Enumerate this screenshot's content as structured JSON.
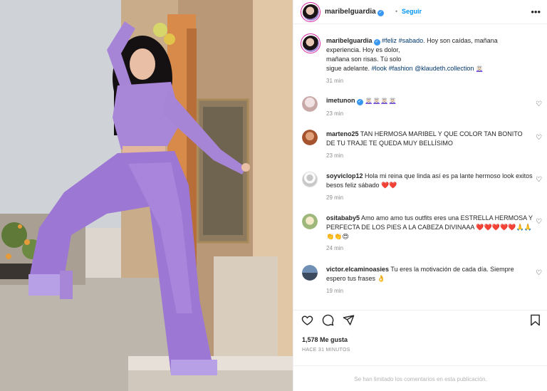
{
  "colors": {
    "accent": "#0095f6",
    "verified": "#3897f0",
    "muted": "#8e8e8e",
    "hashtag": "#00376b",
    "outfit": "#9c77d3"
  },
  "header": {
    "username": "maribelguardia",
    "verified_icon": "verified-badge-icon",
    "separator": "•",
    "follow_label": "Seguir",
    "more_icon": "more-options-icon",
    "more_glyph": "•••"
  },
  "caption": {
    "username": "maribelguardia",
    "parts": {
      "t1": "#feliz",
      "t2": "#sabado",
      "line1": ". Hoy son caídas, mañana",
      "line2": "experiencia. Hoy es dolor,",
      "line3": "mañana son risas. Tú solo",
      "line4a": "sigue adelante. ",
      "t3": "#look",
      "t4": "#fashion",
      "mention": "@klaudeth.collection",
      "emoji": "🧝🏻‍♀️"
    },
    "time": "31 min"
  },
  "comments": [
    {
      "username": "imetunon",
      "verified": true,
      "text": "🧝🏻‍♀️🧝🏻‍♀️🧝🏻‍♀️🧝🏻‍♀️",
      "time": "23 min"
    },
    {
      "username": "marteno25",
      "text": "TAN HERMOSA MARIBEL Y QUE COLOR TAN BONITO DE TU TRAJE TE QUEDA MUY BELLÍSIMO",
      "time": "23 min"
    },
    {
      "username": "soyviclop12",
      "text": "Hola mi reina que linda así es pa lante hermoso look exitos besos feliz sábado ❤️❤️",
      "time": "29 min"
    },
    {
      "username": "ositababy5",
      "text": "Amo amo amo tus outfits eres una ESTRELLA HERMOSA Y PERFECTA DE LOS PIES A LA CABEZA DIVINAAA ❤️❤️❤️❤️❤️🙏🙏👏👏😍",
      "time": "24 min"
    },
    {
      "username": "victor.elcaminoasies",
      "text": "Tu eres la motivación de cada día. Siempre espero tus frases 👌",
      "time": "19 min"
    }
  ],
  "actions": {
    "like_icon": "heart-outline-icon",
    "comment_icon": "comment-icon",
    "share_icon": "share-paper-plane-icon",
    "save_icon": "bookmark-icon"
  },
  "likes": "1,578 Me gusta",
  "timestamp": "HACE 31 MINUTOS",
  "comments_closed": "Se han limitado los comentarios en esta publicación."
}
